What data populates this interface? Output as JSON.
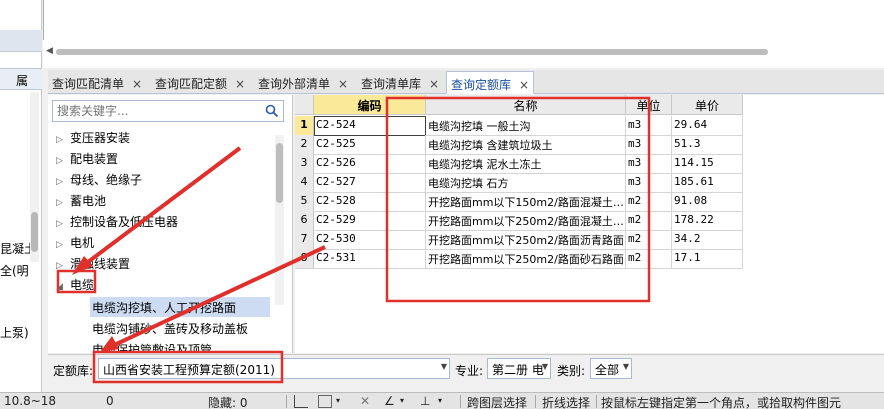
{
  "left_strip": {
    "header": "属",
    "fragments": [
      "昆凝土",
      "全(明",
      "上泵)"
    ]
  },
  "tabs": [
    {
      "label": "查询匹配清单",
      "active": false
    },
    {
      "label": "查询匹配定额",
      "active": false
    },
    {
      "label": "查询外部清单",
      "active": false
    },
    {
      "label": "查询清单库",
      "active": false
    },
    {
      "label": "查询定额库",
      "active": true
    }
  ],
  "tab_close_glyph": "×",
  "search": {
    "placeholder": "搜索关键字..."
  },
  "tree": {
    "items": [
      "变压器安装",
      "配电装置",
      "母线、绝缘子",
      "蓄电池",
      "控制设备及低压电器",
      "电机",
      "滑触线装置",
      "电缆"
    ],
    "children": [
      "电缆沟挖填、人工开挖路面",
      "电缆沟铺砂、盖砖及移动盖板",
      "电缆保护管敷设及顶管"
    ]
  },
  "grid": {
    "columns": [
      "编码",
      "名称",
      "单位",
      "单价"
    ],
    "rows": [
      {
        "num": "1",
        "code": "C2-524",
        "name": "电缆沟挖填 一般土沟",
        "unit": "m3",
        "price": "29.64"
      },
      {
        "num": "2",
        "code": "C2-525",
        "name": "电缆沟挖填 含建筑垃圾土",
        "unit": "m3",
        "price": "51.3"
      },
      {
        "num": "3",
        "code": "C2-526",
        "name": "电缆沟挖填 泥水土冻土",
        "unit": "m3",
        "price": "114.15"
      },
      {
        "num": "4",
        "code": "C2-527",
        "name": "电缆沟挖填 石方",
        "unit": "m3",
        "price": "185.61"
      },
      {
        "num": "5",
        "code": "C2-528",
        "name": "开挖路面mm以下150m2/路面混凝土…",
        "unit": "m2",
        "price": "91.08"
      },
      {
        "num": "6",
        "code": "C2-529",
        "name": "开挖路面mm以下250m2/路面混凝土…",
        "unit": "m2",
        "price": "178.22"
      },
      {
        "num": "7",
        "code": "C2-530",
        "name": "开挖路面mm以下250m2/路面沥青路面",
        "unit": "m2",
        "price": "34.2"
      },
      {
        "num": "8",
        "code": "C2-531",
        "name": "开挖路面mm以下250m2/路面砂石路面",
        "unit": "m2",
        "price": "17.1"
      }
    ]
  },
  "bottom": {
    "library_label": "定额库:",
    "library_value": "山西省安装工程预算定额(2011)",
    "specialty_label": "专业:",
    "specialty_value": "第二册 电",
    "category_label": "类别:",
    "category_value": "全部"
  },
  "status": {
    "range": "10.8~18",
    "count": "0",
    "hidden": "隐藏: 0",
    "span_layer": "跨图层选择",
    "polyline": "折线选择",
    "hint": "按鼠标左键指定第一个角点，或拾取构件图元"
  },
  "colors": {
    "annotation_red": "#e0302c",
    "active_tab_text": "#1a4fa0",
    "selected_row": "#cddcf2",
    "header_highlight": "#fbe99a"
  }
}
